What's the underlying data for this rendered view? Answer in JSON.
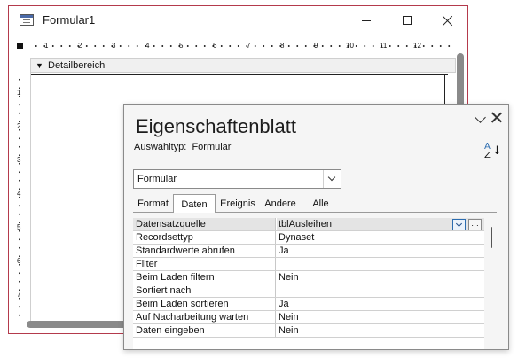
{
  "form_window": {
    "title": "Formular1",
    "section_label": "Detailbereich",
    "ruler_numbers_h": [
      "1",
      "2",
      "3",
      "4",
      "5",
      "6",
      "7",
      "8",
      "9",
      "10",
      "11",
      "12"
    ],
    "ruler_numbers_v": [
      "1",
      "2",
      "3",
      "4",
      "5",
      "6",
      "7"
    ],
    "icons": {
      "form": "form-icon",
      "minimize": "minimize-icon",
      "maximize": "maximize-icon",
      "close": "close-icon",
      "section": "chevron-down-icon"
    }
  },
  "property_sheet": {
    "title": "Eigenschaftenblatt",
    "selection_type_label": "Auswahltyp:",
    "selection_type_value": "Formular",
    "object_dropdown_value": "Formular",
    "sort_icon_letters": {
      "top": "A",
      "bottom": "Z"
    },
    "tabs": [
      {
        "label": "Format",
        "active": false
      },
      {
        "label": "Daten",
        "active": true
      },
      {
        "label": "Ereignis",
        "active": false
      },
      {
        "label": "Andere",
        "active": false
      },
      {
        "label": "Alle",
        "active": false
      }
    ],
    "properties": [
      {
        "name": "Datensatzquelle",
        "value": "tblAusleihen",
        "selected": true
      },
      {
        "name": "Recordsettyp",
        "value": "Dynaset"
      },
      {
        "name": "Standardwerte abrufen",
        "value": "Ja"
      },
      {
        "name": "Filter",
        "value": ""
      },
      {
        "name": "Beim Laden filtern",
        "value": "Nein"
      },
      {
        "name": "Sortiert nach",
        "value": ""
      },
      {
        "name": "Beim Laden sortieren",
        "value": "Ja"
      },
      {
        "name": "Auf Nacharbeitung warten",
        "value": "Nein"
      },
      {
        "name": "Daten eingeben",
        "value": "Nein"
      }
    ],
    "build_button_label": "…",
    "icons": {
      "collapse": "chevron-down-icon",
      "close": "close-icon",
      "sort": "sort-az-icon",
      "dropdown": "dropdown-arrow-icon",
      "builder": "builder-ellipsis-icon"
    }
  },
  "colors": {
    "window_border": "#b43a4c",
    "accent_blue": "#2b6cb0",
    "scrollbar": "#8a8a8a",
    "panel_bg": "#f5f5f5"
  }
}
